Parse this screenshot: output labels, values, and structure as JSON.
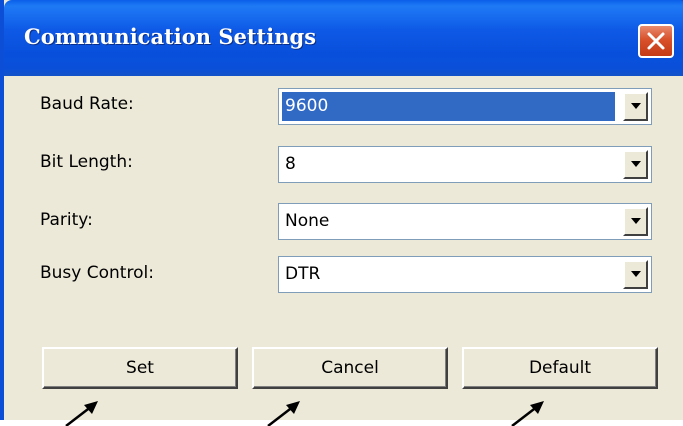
{
  "window": {
    "title": "Communication Settings",
    "close_icon": "close-icon"
  },
  "fields": [
    {
      "label": "Baud Rate:",
      "value": "9600",
      "selected": true
    },
    {
      "label": "Bit Length:",
      "value": "8",
      "selected": false
    },
    {
      "label": "Parity:",
      "value": "None",
      "selected": false
    },
    {
      "label": "Busy Control:",
      "value": "DTR",
      "selected": false
    }
  ],
  "buttons": {
    "set": "Set",
    "cancel": "Cancel",
    "default": "Default"
  },
  "colors": {
    "titlebar": "#0a53de",
    "dialog_bg": "#ece9d8",
    "selection": "#316ac5",
    "close_button": "#d8512b",
    "annotation_arrow": "#000000"
  },
  "annotations": {
    "arrow_icon": "pointer-arrow-icon",
    "arrow_count": 3
  }
}
